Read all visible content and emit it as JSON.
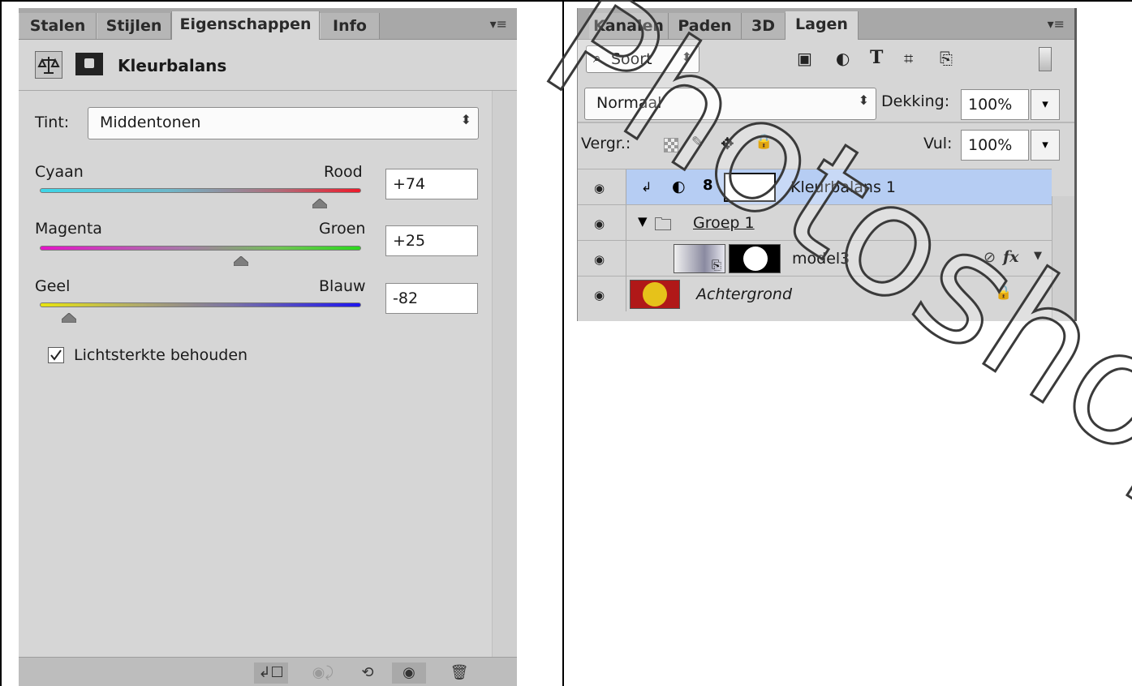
{
  "properties_panel": {
    "tabs": [
      "Stalen",
      "Stijlen",
      "Eigenschappen",
      "Info"
    ],
    "active_tab": "Eigenschappen",
    "title": "Kleurbalans",
    "tint_label": "Tint:",
    "tint_value": "Middentonen",
    "sliders": [
      {
        "left_label": "Cyaan",
        "right_label": "Rood",
        "value": "+74",
        "numeric": 74
      },
      {
        "left_label": "Magenta",
        "right_label": "Groen",
        "value": "+25",
        "numeric": 25
      },
      {
        "left_label": "Geel",
        "right_label": "Blauw",
        "value": "-82",
        "numeric": -82
      }
    ],
    "preserve_luminosity_label": "Lichtsterkte behouden",
    "preserve_luminosity_checked": true
  },
  "layers_panel": {
    "tabs": [
      "Kanalen",
      "Paden",
      "3D",
      "Lagen"
    ],
    "active_tab": "Lagen",
    "filter_label": "Soort",
    "blend_mode": "Normaal",
    "opacity_label": "Dekking:",
    "opacity_value": "100%",
    "lock_label": "Vergr.:",
    "fill_label": "Vul:",
    "fill_value": "100%",
    "layers": [
      {
        "name": "Kleurbalans 1",
        "selected": true
      },
      {
        "name": "Groep 1",
        "selected": false
      },
      {
        "name": "model3",
        "selected": false
      },
      {
        "name": "Achtergrond",
        "selected": false
      }
    ]
  },
  "watermark_text": "Photoshop ©",
  "colors": {
    "panel_bg": "#d6d6d6",
    "selected_layer": "#b6cdf3",
    "tab_bar": "#a8a8a8"
  }
}
